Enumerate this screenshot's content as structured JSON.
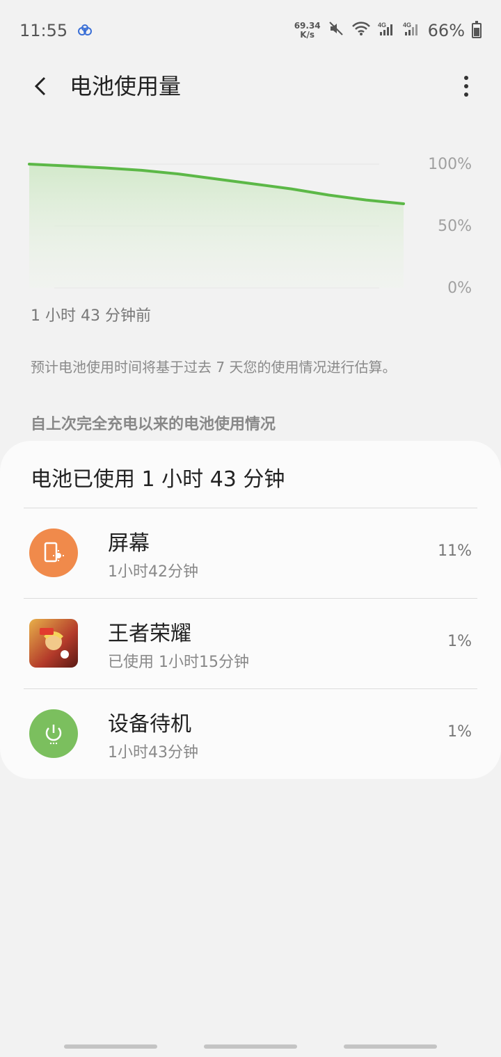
{
  "status_bar": {
    "time": "11:55",
    "net_speed_value": "69.34",
    "net_speed_unit": "K/s",
    "battery_percent": "66%"
  },
  "header": {
    "title": "电池使用量"
  },
  "chart_data": {
    "type": "area",
    "x_label_start": "1 小时 43 分钟前",
    "y_ticks": [
      "100%",
      "50%",
      "0%"
    ],
    "ylim": [
      0,
      100
    ],
    "values": [
      100,
      98.5,
      97,
      95,
      92,
      88,
      84,
      80,
      75,
      71,
      68
    ],
    "color": "#5cb847"
  },
  "estimate_note": "预计电池使用时间将基于过去 7 天您的使用情况进行估算。",
  "section_header": "自上次完全充电以来的电池使用情况",
  "usage_card": {
    "title": "电池已使用 1 小时 43 分钟",
    "items": [
      {
        "name": "屏幕",
        "duration": "1小时42分钟",
        "percent": "11%",
        "icon": "screen-brightness-icon",
        "color": "#f08a4b"
      },
      {
        "name": "王者荣耀",
        "duration": "已使用 1小时15分钟",
        "percent": "1%",
        "icon": "game-app-icon",
        "color": "#b33a2a"
      },
      {
        "name": "设备待机",
        "duration": "1小时43分钟",
        "percent": "1%",
        "icon": "power-icon",
        "color": "#7bbf5e"
      }
    ]
  }
}
